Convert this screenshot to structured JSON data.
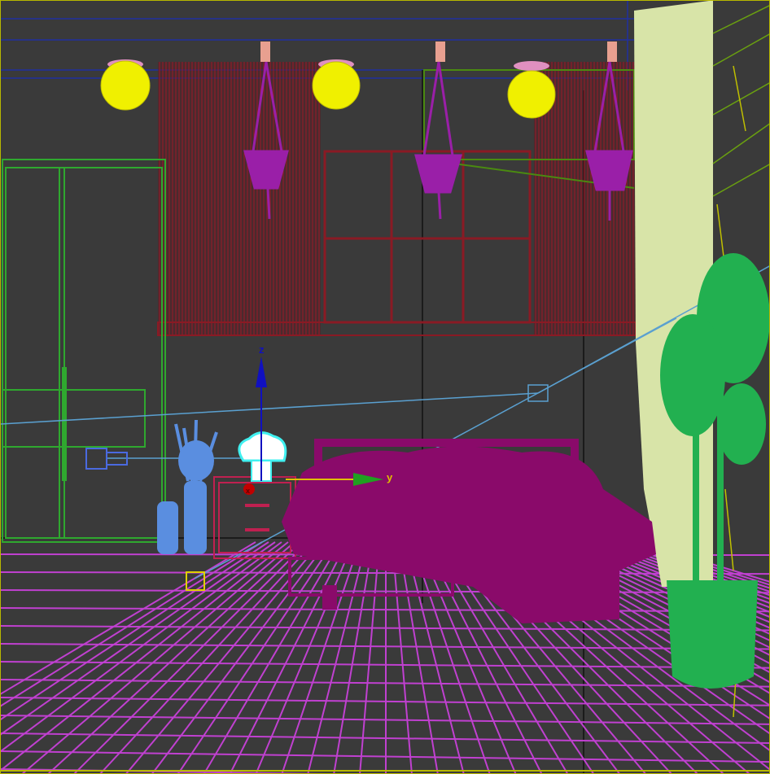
{
  "viewport": {
    "gizmo": {
      "z_label": "z",
      "y_label": "y",
      "x_label": "x"
    },
    "colors": {
      "background": "#3a3a3a",
      "curtain": "#8a1a24",
      "wardrobe": "#2fa82f",
      "lamp": "#f0f000",
      "plant_hanging": "#9a1fa8",
      "bed": "#8a0a6a",
      "floor": "#c040d0",
      "column": "#d8e4a8",
      "floor_plant": "#22b050",
      "vase": "#5a8ee0"
    }
  }
}
